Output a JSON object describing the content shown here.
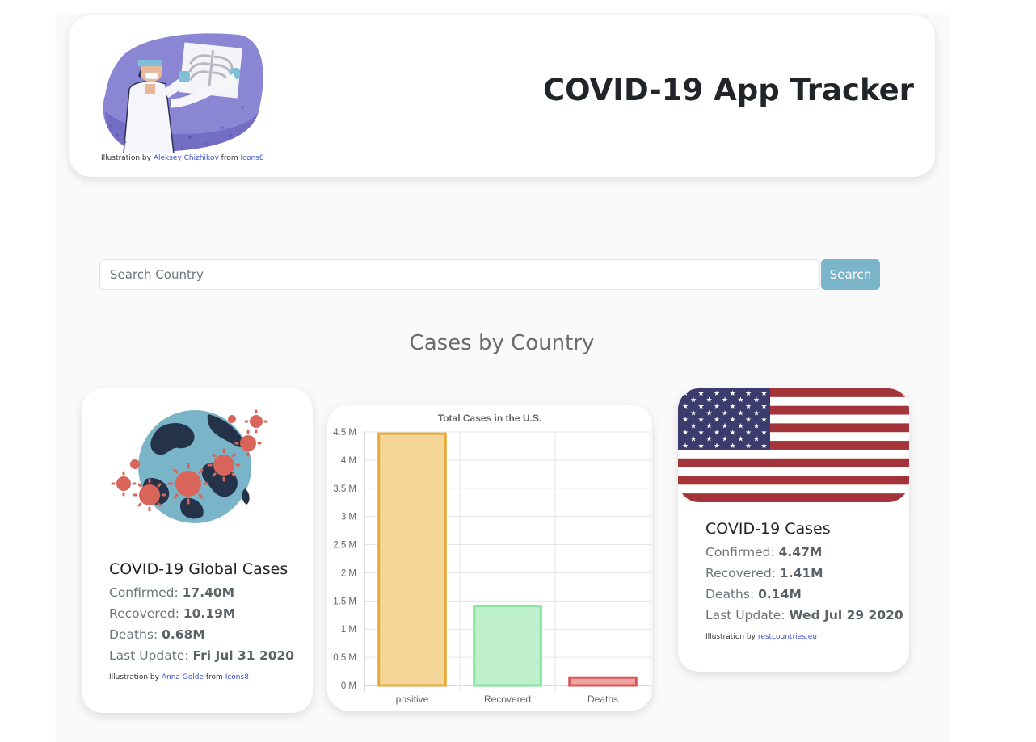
{
  "header": {
    "title": "COVID-19 App Tracker",
    "credit_prefix": "Illustration by",
    "credit_author": "Aleksey Chizhikov",
    "credit_mid": "from",
    "credit_source": "Icons8"
  },
  "search": {
    "placeholder": "Search Country",
    "button_label": "Search"
  },
  "section_title": "Cases by Country",
  "global_card": {
    "title": "COVID-19 Global Cases",
    "confirmed_label": "Confirmed:",
    "confirmed_value": "17.40M",
    "recovered_label": "Recovered:",
    "recovered_value": "10.19M",
    "deaths_label": "Deaths:",
    "deaths_value": "0.68M",
    "update_label": "Last Update:",
    "update_value": "Fri Jul 31 2020",
    "credit_prefix": "Illustration by",
    "credit_author": "Anna Golde",
    "credit_mid": "from",
    "credit_source": "Icons8"
  },
  "us_card": {
    "title": "COVID-19 Cases",
    "confirmed_label": "Confirmed:",
    "confirmed_value": "4.47M",
    "recovered_label": "Recovered:",
    "recovered_value": "1.41M",
    "deaths_label": "Deaths:",
    "deaths_value": "0.14M",
    "update_label": "Last Update:",
    "update_value": "Wed Jul 29 2020",
    "credit_prefix": "Illustration by",
    "credit_source": "restcountries.eu"
  },
  "chart_data": {
    "type": "bar",
    "title": "Total Cases in the U.S.",
    "categories": [
      "positive",
      "Recovered",
      "Deaths"
    ],
    "values": [
      4470000,
      1410000,
      140000
    ],
    "ylim": [
      0,
      4500000
    ],
    "yticks": [
      0,
      500000,
      1000000,
      1500000,
      2000000,
      2500000,
      3000000,
      3500000,
      4000000,
      4500000
    ],
    "ytick_labels": [
      "0 M",
      "0.5 M",
      "1 M",
      "1.5 M",
      "2 M",
      "2.5 M",
      "3 M",
      "3.5 M",
      "4 M",
      "4.5 M"
    ],
    "grid": true,
    "bar_fills": [
      "#f5d699",
      "#bff0cc",
      "#eea3a3"
    ],
    "bar_strokes": [
      "#e8a93a",
      "#86e39e",
      "#d95757"
    ]
  },
  "colors": {
    "search_button": "#7ab4c8",
    "link": "#3a4fd0",
    "flag_red": "#a3353a",
    "flag_blue": "#3c3b6e"
  }
}
